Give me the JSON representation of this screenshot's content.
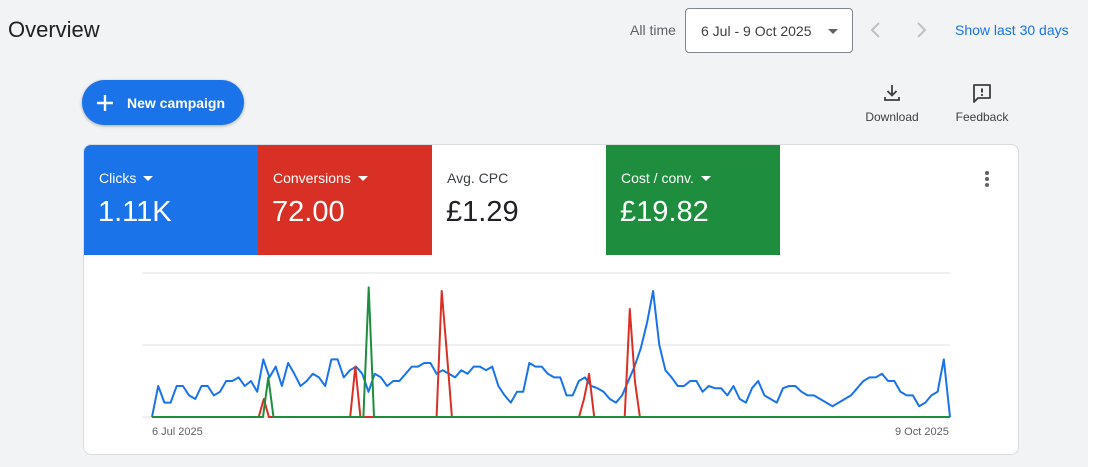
{
  "header": {
    "title": "Overview",
    "all_time_label": "All time",
    "date_range": "6 Jul - 9 Oct 2025",
    "show_last_label": "Show last 30 days"
  },
  "toolbar": {
    "new_campaign_label": "New campaign",
    "download_label": "Download",
    "feedback_label": "Feedback"
  },
  "metrics": [
    {
      "label": "Clicks",
      "value": "1.11K",
      "color": "#1a73e8",
      "has_dropdown": true
    },
    {
      "label": "Conversions",
      "value": "72.00",
      "color": "#d93025",
      "has_dropdown": true
    },
    {
      "label": "Avg. CPC",
      "value": "£1.29",
      "color": "#ffffff",
      "has_dropdown": false
    },
    {
      "label": "Cost / conv.",
      "value": "£19.82",
      "color": "#1e8e3e",
      "has_dropdown": true
    }
  ],
  "chart_data": {
    "type": "line",
    "x_start_label": "6 Jul 2025",
    "x_end_label": "9 Oct 2025",
    "grid": true,
    "ylim": [
      0,
      20
    ],
    "series": [
      {
        "metric": "Clicks",
        "color": "#1a73e8",
        "values": [
          0,
          4.3,
          2,
          2,
          4.3,
          4.3,
          3,
          2.5,
          4.3,
          4.3,
          3,
          3.5,
          5,
          5,
          5.5,
          4.3,
          5,
          3.5,
          8,
          5.5,
          7,
          4.3,
          7.5,
          6,
          4.3,
          5,
          6,
          5.5,
          4.3,
          8,
          8,
          5.5,
          6.5,
          7,
          6,
          3.5,
          6,
          5.5,
          4.3,
          5,
          5,
          6,
          7,
          7,
          7.5,
          7.5,
          6,
          6.5,
          6,
          5.5,
          6.5,
          6,
          7,
          7,
          6.5,
          7,
          4.3,
          3,
          2,
          3.5,
          3.5,
          7.5,
          7,
          7,
          6,
          5.5,
          5.5,
          3,
          3,
          5,
          5.5,
          4.3,
          4,
          3.5,
          2.5,
          2,
          3,
          5,
          7,
          9.5,
          13,
          17.5,
          10,
          6.5,
          5.5,
          4.3,
          4.3,
          5,
          5,
          3.5,
          4.3,
          4,
          4,
          3,
          4.3,
          2.5,
          2,
          4,
          5,
          3,
          2.5,
          2,
          4,
          4.3,
          4.3,
          3.5,
          3,
          3,
          2.5,
          2,
          1.5,
          2,
          2.5,
          3,
          4,
          5,
          5.5,
          5.5,
          6,
          5,
          5,
          3.5,
          3,
          3,
          1.5,
          2,
          3,
          3.5,
          8,
          0
        ]
      },
      {
        "metric": "Conversions",
        "color": "#d93025",
        "values": [
          0,
          0,
          0,
          0,
          0,
          0,
          0,
          0,
          0,
          0,
          0,
          0,
          0,
          0,
          0,
          0,
          0,
          0,
          0,
          0,
          0,
          0,
          2.5,
          0,
          0,
          0,
          0,
          0,
          0,
          0,
          0,
          0,
          0,
          0,
          0,
          0,
          0,
          0,
          0,
          0,
          7,
          0,
          0,
          0,
          0,
          0,
          0,
          0,
          0,
          0,
          0,
          0,
          0,
          0,
          0,
          0,
          0,
          17.5,
          9,
          0,
          0,
          0,
          0,
          0,
          0,
          0,
          0,
          0,
          0,
          0,
          0,
          0,
          0,
          0,
          0,
          0,
          0,
          0,
          0,
          0,
          0,
          0,
          0,
          0,
          0,
          2.5,
          6,
          0,
          0,
          0,
          0,
          0,
          0,
          0,
          15,
          5,
          0,
          0,
          0,
          0,
          0,
          0,
          0,
          0,
          0,
          0,
          0,
          0,
          0,
          0,
          0,
          0,
          0,
          0,
          0,
          0,
          0,
          0,
          0,
          0,
          0,
          0,
          0,
          0,
          0,
          0,
          0,
          0,
          0,
          0,
          0,
          0,
          0,
          0,
          0,
          0,
          0,
          0,
          0,
          0,
          0,
          0,
          0,
          0,
          0,
          0,
          0,
          0,
          0,
          0,
          0,
          0,
          0,
          0,
          0,
          0,
          0,
          0
        ]
      },
      {
        "metric": "Cost / conv.",
        "color": "#1e8e3e",
        "values": [
          0,
          0,
          0,
          0,
          0,
          0,
          0,
          0,
          0,
          0,
          0,
          0,
          0,
          0,
          0,
          0,
          0,
          0,
          0,
          0,
          0,
          0,
          5.5,
          0,
          0,
          0,
          0,
          0,
          0,
          0,
          0,
          0,
          0,
          0,
          0,
          0,
          0,
          0,
          0,
          0,
          0,
          18,
          0,
          0,
          0,
          0,
          0,
          0,
          0,
          0,
          0,
          0,
          0,
          0,
          0,
          0,
          0,
          0,
          0,
          0,
          0,
          0,
          0,
          0,
          0,
          0,
          0,
          0,
          0,
          0,
          0,
          0,
          0,
          0,
          0,
          0,
          0,
          0,
          0,
          0,
          0,
          0,
          0,
          0,
          0,
          0,
          0,
          0,
          0,
          0,
          0,
          0,
          0,
          0,
          0,
          0,
          0,
          0,
          0,
          0,
          0,
          0,
          0,
          0,
          0,
          0,
          0,
          0,
          0,
          0,
          0,
          0,
          0,
          0,
          0,
          0,
          0,
          0,
          0,
          0,
          0,
          0,
          0,
          0,
          0,
          0,
          0,
          0,
          0,
          0,
          0,
          0,
          0,
          0,
          0,
          0,
          0,
          0,
          0,
          0,
          0,
          0,
          0,
          0,
          0,
          0,
          0,
          0,
          0,
          0,
          0,
          0
        ]
      }
    ]
  }
}
